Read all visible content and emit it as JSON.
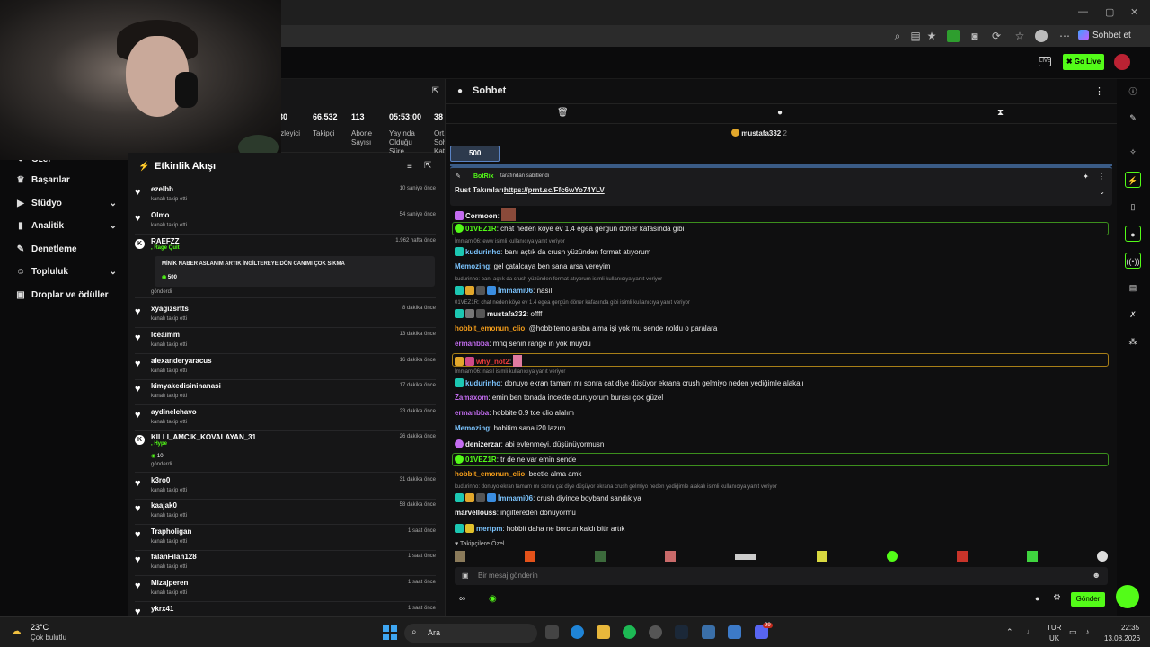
{
  "browser": {
    "chat_button": "Sohbet et",
    "minimize": "—",
    "maximize": "▢",
    "close": "✕"
  },
  "header": {
    "go_live": "Go Live",
    "live_badge": "LIVE"
  },
  "sidebar": {
    "items": [
      {
        "label": "Özel",
        "icon": "user-icon"
      },
      {
        "label": "Başarılar",
        "icon": "trophy-icon"
      },
      {
        "label": "Stüdyo",
        "icon": "video-icon",
        "expandable": true
      },
      {
        "label": "Analitik",
        "icon": "chart-icon",
        "expandable": true
      },
      {
        "label": "Denetleme",
        "icon": "wrench-icon"
      },
      {
        "label": "Topluluk",
        "icon": "people-icon",
        "expandable": true
      },
      {
        "label": "Droplar ve ödüller",
        "icon": "gift-icon"
      }
    ]
  },
  "stats": [
    {
      "value": "30",
      "label": "İzleyici"
    },
    {
      "value": "66.532",
      "label": "Takipçi"
    },
    {
      "value": "113",
      "label": "Abone Sayısı"
    },
    {
      "value": "05:53:00",
      "label": "Yayında Olduğu Süre"
    },
    {
      "value": "38",
      "label": "Ort. Sohbet Katılımı"
    }
  ],
  "feed": {
    "title": "Etkinlik Akışı",
    "items": [
      {
        "user": "ezelbb",
        "desc": "kanalı takip etti",
        "time": "10 saniye önce",
        "type": "follow"
      },
      {
        "user": "Olmo",
        "desc": "kanalı takip etti",
        "time": "54 saniye önce",
        "type": "follow"
      },
      {
        "user": "RAEFZZ",
        "sub": ", Rage Quit",
        "message": "MİNİK NABER ASLANIM ARTIK İNGİLTEREYE DÖN CANIMI ÇOK SIKMA",
        "kicks": "500",
        "desc": "gönderdi",
        "time": "1.962 hafta önce",
        "type": "kick"
      },
      {
        "user": "xyagizsrtts",
        "desc": "kanalı takip etti",
        "time": "8 dakika önce",
        "type": "follow"
      },
      {
        "user": "lceaimm",
        "desc": "kanalı takip etti",
        "time": "13 dakika önce",
        "type": "follow"
      },
      {
        "user": "alexanderyaracus",
        "desc": "kanalı takip etti",
        "time": "16 dakika önce",
        "type": "follow"
      },
      {
        "user": "kimyakedisininanasi",
        "desc": "kanalı takip etti",
        "time": "17 dakika önce",
        "type": "follow"
      },
      {
        "user": "aydinelchavo",
        "desc": "kanalı takip etti",
        "time": "23 dakika önce",
        "type": "follow"
      },
      {
        "user": "KILLI_AMCIK_KOVALAYAN_31",
        "sub": ", Hype",
        "kicks": "10",
        "desc": "gönderdi",
        "time": "26 dakika önce",
        "type": "kick"
      },
      {
        "user": "k3ro0",
        "desc": "kanalı takip etti",
        "time": "31 dakika önce",
        "type": "follow"
      },
      {
        "user": "kaajak0",
        "desc": "kanalı takip etti",
        "time": "58 dakika önce",
        "type": "follow"
      },
      {
        "user": "Trapholigan",
        "desc": "kanalı takip etti",
        "time": "1 saat önce",
        "type": "follow"
      },
      {
        "user": "falanFilan128",
        "desc": "kanalı takip etti",
        "time": "1 saat önce",
        "type": "follow"
      },
      {
        "user": "Mizajperen",
        "desc": "kanalı takip etti",
        "time": "1 saat önce",
        "type": "follow"
      },
      {
        "user": "ykrx41",
        "desc": "",
        "time": "1 saat önce",
        "type": "follow"
      }
    ]
  },
  "chat": {
    "title": "Sohbet",
    "top_gifter": "mustafa332",
    "top_gifter_count": "2",
    "kick_goal": "500",
    "pinned": {
      "by": "BotRix",
      "by_suffix": "tarafından sabitlendi",
      "label": "Rust Takımları:",
      "link": "https://prnt.sc/Ffc6wYo74YLV"
    },
    "messages": [
      {
        "user": "Cormoon",
        "text": "",
        "color": "#f5f5f5"
      },
      {
        "user": "01VEZ1R",
        "text": "chat neden köye ev 1.4 egea gergün döner kafasında gibi",
        "color": "#53fc18",
        "hl": "green"
      },
      {
        "reply": "İmmami06: eww isimli kullanıcıya yanıt veriyor"
      },
      {
        "user": "kudurinho",
        "text": "banı açtık da crush yüzünden format atıyorum",
        "color": "#7cc5ff"
      },
      {
        "user": "Memozing",
        "text": "gel çatalcaya ben sana arsa vereyim",
        "color": "#7cc5ff"
      },
      {
        "reply": "kudurinho: banı açtık da crush yüzünden format atıyorum isimli kullanıcıya yanıt veriyor"
      },
      {
        "user": "İmmami06",
        "text": "nasıl",
        "color": "#7cc5ff"
      },
      {
        "reply": "01VEZ1R: chat neden köye ev 1.4 egea gergün döner kafasında gibi isimli kullanıcıya yanıt veriyor"
      },
      {
        "user": "mustafa332",
        "text": "offff",
        "color": "#f5f5f5"
      },
      {
        "user": "hobbit_emonun_clio",
        "text": "@hobbitemo araba alma işi yok mu sende noldu o paralara",
        "color": "#f59e1b",
        "mention": "@hobbitemo"
      },
      {
        "user": "ermanbba",
        "text": "mnq senin range in yok muydu",
        "color": "#c36cf0"
      },
      {
        "user": "why_not2",
        "text": "",
        "color": "#ef3b3b",
        "hl": "gold"
      },
      {
        "reply": "İmmami06: nasıl isimli kullanıcıya yanıt veriyor"
      },
      {
        "user": "kudurinho",
        "text": "donuyo ekran tamam mı sonra çat diye düşüyor ekrana crush gelmiyo neden yediğimle alakalı",
        "color": "#7cc5ff"
      },
      {
        "user": "Zamaxom",
        "text": "emin ben tonada incekte oturuyorum burası çok güzel",
        "color": "#c36cf0"
      },
      {
        "user": "ermanbba",
        "text": "hobbite 0.9 tce clio alalım",
        "color": "#c36cf0"
      },
      {
        "user": "Memozing",
        "text": "hobitim sana i20 lazım",
        "color": "#7cc5ff"
      },
      {
        "user": "denizerzar",
        "text": "abi evlenmeyi. düşünüyormusn",
        "color": "#f5f5f5"
      },
      {
        "user": "01VEZ1R",
        "text": "tr de ne var emin sende",
        "color": "#53fc18",
        "hl": "green"
      },
      {
        "user": "hobbit_emonun_clio",
        "text": "beetle alma amk",
        "color": "#f59e1b"
      },
      {
        "reply": "kudurinho: donuyo ekran tamam mı sonra çat diye düşüyor ekrana crush gelmiyo neden yediğimle alakalı isimli kullanıcıya yanıt veriyor"
      },
      {
        "user": "İmmami06",
        "text": "crush diyince boyband sandık ya",
        "color": "#7cc5ff"
      },
      {
        "user": "marvellouss",
        "text": "ingiltereden dönüyormu",
        "color": "#f5f5f5"
      },
      {
        "user": "mertpm",
        "text": "hobbit daha ne borcun kaldı bitir artık",
        "color": "#7cc5ff"
      }
    ],
    "emote_label": "Takipçilere Özel",
    "input_placeholder": "Bir mesaj gönderin",
    "send": "Gönder"
  },
  "taskbar": {
    "weather_temp": "23°C",
    "weather_desc": "Çok bulutlu",
    "search": "Ara",
    "lang_top": "TUR",
    "lang_bottom": "UK",
    "time": "22:35",
    "date": "13.08.2026",
    "notif_badge": "99"
  },
  "colors": {
    "kick_green": "#53fc18",
    "panel": "#161617",
    "bg": "#0b0b0c"
  }
}
